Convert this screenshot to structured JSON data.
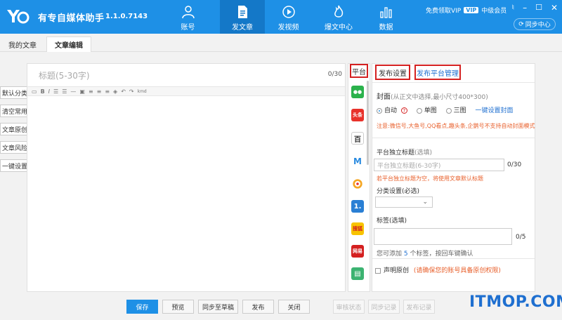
{
  "app": {
    "title": "有专自媒体助手",
    "version": "1.1.0.7143"
  },
  "nav": [
    {
      "label": "账号",
      "icon": "user-icon"
    },
    {
      "label": "发文章",
      "icon": "document-icon"
    },
    {
      "label": "发视频",
      "icon": "play-icon"
    },
    {
      "label": "爆文中心",
      "icon": "flame-icon"
    },
    {
      "label": "数据",
      "icon": "bar-chart-icon"
    }
  ],
  "header": {
    "free_vip": "免费领取VIP",
    "vip_badge": "VIP",
    "member_level": "中级会员",
    "sync_label": "同步中心"
  },
  "tabs": {
    "my_articles": "我的文章",
    "edit_article": "文章编辑"
  },
  "sidebar": [
    "默认分类",
    "清空常用",
    "文章原创",
    "文章风险",
    "一键设置"
  ],
  "editor": {
    "title_placeholder": "标题(5-30字)",
    "title_count": "0/30"
  },
  "platforms": {
    "header": "平台",
    "items": [
      {
        "name": "wechat",
        "label": "",
        "color": "#2bb24c"
      },
      {
        "name": "toutiao",
        "label": "头条",
        "color": "#e8312a"
      },
      {
        "name": "baijia",
        "label": "百",
        "color": "#333333"
      },
      {
        "name": "zaker",
        "label": "",
        "color": "#2a8be0"
      },
      {
        "name": "qiehao",
        "label": "",
        "color": "#f5a623"
      },
      {
        "name": "yidian",
        "label": "1.",
        "color": "#2a7fd4"
      },
      {
        "name": "sohu",
        "label": "搜狐",
        "color": "#f8c300"
      },
      {
        "name": "netease",
        "label": "网易",
        "color": "#d42020"
      },
      {
        "name": "other",
        "label": "",
        "color": "#3cb371"
      }
    ]
  },
  "settings": {
    "tab_publish": "发布设置",
    "tab_manage": "发布平台管理",
    "cover_label": "封面",
    "cover_hint": "(从正文中选择,最小尺寸400*300)",
    "cover_options": [
      "自动",
      "单图",
      "三图"
    ],
    "one_click_cover": "一键设置封面",
    "cover_note": "注意:微信号,大鱼号,QQ看点,趣头条,企鹅号不支持自动封面模式",
    "platform_title_label": "平台独立标题",
    "platform_title_optional": "(选填)",
    "platform_title_placeholder": "平台独立标题(6-30字)",
    "platform_title_count": "0/30",
    "platform_title_note": "若平台独立标题为空，将使用文章默认标题",
    "category_label": "分类设置(必选)",
    "tags_label": "标签(选填)",
    "tags_count": "0/5",
    "tags_hint_pre": "您可添加",
    "tags_hint_num": "5",
    "tags_hint_post": "个标签，按回车键确认",
    "original_label": "声明原创",
    "original_note": "(请确保您的账号具备原创权限)"
  },
  "buttons": {
    "save": "保存",
    "preview": "预览",
    "sync_draft": "同步至草稿",
    "publish": "发布",
    "close": "关闭",
    "review_status": "审核状态",
    "sync_record": "同步记录",
    "publish_record": "发布记录"
  },
  "watermark": "ITMOP.COM",
  "colors": {
    "primary": "#1e90e6",
    "highlight": "#d42020",
    "warn": "#e8602c"
  }
}
